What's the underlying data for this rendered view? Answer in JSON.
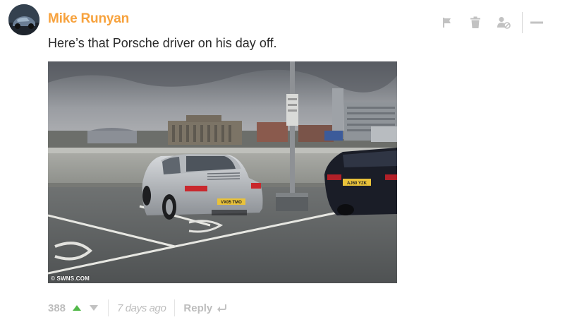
{
  "comment": {
    "author": "Mike Runyan",
    "text": "Here’s that Porsche driver on his day off.",
    "avatar_icon": "avatar-car-icon",
    "image": {
      "watermark": "© SWNS.COM",
      "plates": {
        "porsche": "VX05 TMO",
        "bmw": "AJ60 YZK"
      }
    },
    "score": "388",
    "timestamp": "7 days ago",
    "reply_label": "Reply"
  },
  "toolbar": {
    "icons": [
      "flag-icon",
      "trash-icon",
      "user-block-icon",
      "collapse-icon"
    ]
  },
  "colors": {
    "author": "#f7a23d",
    "upvote": "#53b94a",
    "muted": "#bdbdbd",
    "icon": "#c2c2c2"
  }
}
